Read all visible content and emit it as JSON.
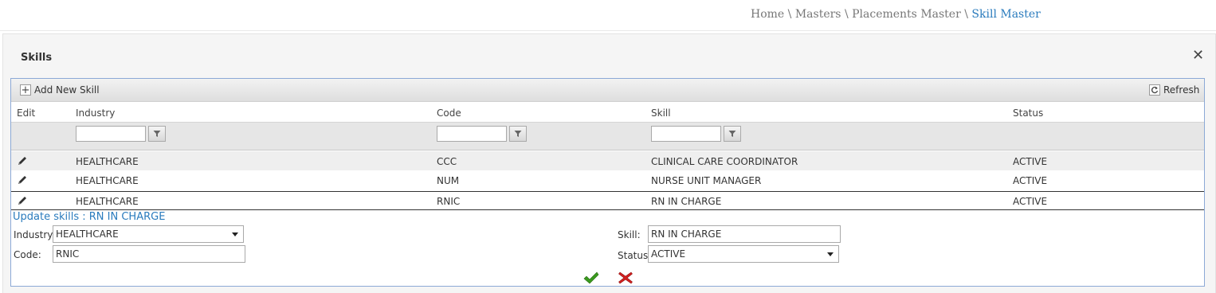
{
  "breadcrumb": {
    "items": [
      "Home",
      "Masters",
      "Placements Master"
    ],
    "separator": "\\",
    "current": "Skill Master"
  },
  "panel": {
    "title": "Skills",
    "close_icon": "close-icon"
  },
  "toolbar": {
    "add_label": "Add New Skill",
    "refresh_label": "Refresh"
  },
  "table": {
    "columns": [
      "Edit",
      "Industry",
      "Code",
      "Skill",
      "Status"
    ],
    "rows": [
      {
        "industry": "HEALTHCARE",
        "code": "CCC",
        "skill": "CLINICAL CARE COORDINATOR",
        "status": "ACTIVE"
      },
      {
        "industry": "HEALTHCARE",
        "code": "NUM",
        "skill": "NURSE UNIT MANAGER",
        "status": "ACTIVE"
      },
      {
        "industry": "HEALTHCARE",
        "code": "RNIC",
        "skill": "RN IN CHARGE",
        "status": "ACTIVE"
      }
    ]
  },
  "edit_form": {
    "title": "Update skills : RN IN CHARGE",
    "industry_label": "Industry:",
    "industry_value": "HEALTHCARE",
    "code_label": "Code:",
    "code_value": "RNIC",
    "skill_label": "Skill:",
    "skill_value": "RN IN CHARGE",
    "status_label": "Status:",
    "status_value": "ACTIVE"
  },
  "colors": {
    "accent": "#2a7bbd",
    "grid_border": "#8ca9d6",
    "confirm": "#3a9a1e",
    "cancel": "#d42020"
  }
}
